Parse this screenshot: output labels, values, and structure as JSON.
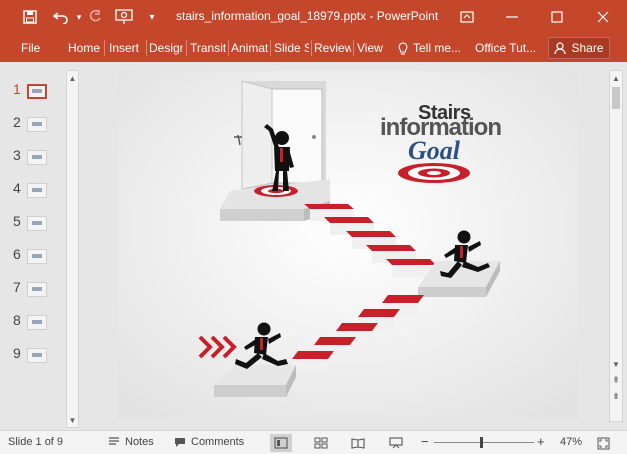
{
  "titlebar": {
    "document_title": "stairs_information_goal_18979.pptx - PowerPoint",
    "save_icon": "save-icon",
    "undo_icon": "undo-icon",
    "redo_icon": "redo-icon",
    "present_icon": "present-from-beginning-icon",
    "customize_icon": "customize-qat-icon"
  },
  "ribbon": {
    "tabs": [
      "File",
      "Home",
      "Insert",
      "Design",
      "Transitions",
      "Animations",
      "Slide Show",
      "Review",
      "View"
    ],
    "tell_me": "Tell me...",
    "office_tut": "Office Tut...",
    "share": "Share"
  },
  "thumbnails": [
    "1",
    "2",
    "3",
    "4",
    "5",
    "6",
    "7",
    "8",
    "9"
  ],
  "active_slide_index": 0,
  "slide": {
    "title_line1": "Stairs",
    "title_line2": "information",
    "title_line3": "Goal"
  },
  "status": {
    "slide_counter": "Slide 1 of 9",
    "notes": "Notes",
    "comments": "Comments",
    "zoom_minus": "−",
    "zoom_plus": "+",
    "zoom_level": "47%",
    "zoom_fraction": 0.47
  },
  "colors": {
    "accent": "#c4472c",
    "stair_red": "#c8202a",
    "goal_blue": "#2c4f86"
  }
}
